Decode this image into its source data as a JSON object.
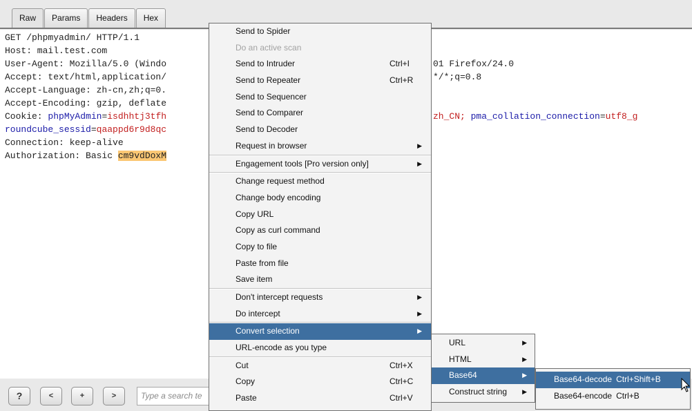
{
  "tabs": [
    "Raw",
    "Params",
    "Headers",
    "Hex"
  ],
  "request": {
    "line1": "GET /phpmyadmin/ HTTP/1.1",
    "line2": "Host: mail.test.com",
    "line3a": "User-Agent: Mozilla/5.0 (Windo",
    "line3b": "01 Firefox/24.0",
    "line4a": "Accept: text/html,application/",
    "line4b": "*/*;q=0.8",
    "line5": "Accept-Language: zh-cn,zh;q=0.",
    "line6": "Accept-Encoding: gzip, deflate",
    "cookie_prefix": "Cookie: ",
    "cookie_key1": "phpMyAdmin",
    "cookie_eq": "=",
    "cookie_val1": "isdhhtj3tfh",
    "cookie_tail_val": "zh_CN; ",
    "cookie_key2": "pma_collation_connection",
    "cookie_eq2": "=",
    "cookie_val2": "utf8_g",
    "rc_key": "roundcube_sessid",
    "rc_eq": "=",
    "rc_val": "qaappd6r9d8qc",
    "connection": "Connection: keep-alive",
    "auth_prefix": "Authorization: Basic ",
    "auth_value": "cm9vdDoxM"
  },
  "bottom": {
    "help": "?",
    "prev": "<",
    "plus": "+",
    "next": ">",
    "search_placeholder": "Type a search te"
  },
  "context_menu": {
    "send_to_spider": "Send to Spider",
    "active_scan": "Do an active scan",
    "send_to_intruder": "Send to Intruder",
    "send_to_intruder_sc": "Ctrl+I",
    "send_to_repeater": "Send to Repeater",
    "send_to_repeater_sc": "Ctrl+R",
    "send_to_sequencer": "Send to Sequencer",
    "send_to_comparer": "Send to Comparer",
    "send_to_decoder": "Send to Decoder",
    "request_in_browser": "Request in browser",
    "engagement_tools": "Engagement tools [Pro version only]",
    "change_method": "Change request method",
    "change_encoding": "Change body encoding",
    "copy_url": "Copy URL",
    "copy_curl": "Copy as curl command",
    "copy_to_file": "Copy to file",
    "paste_from_file": "Paste from file",
    "save_item": "Save item",
    "dont_intercept": "Don't intercept requests",
    "do_intercept": "Do intercept",
    "convert_selection": "Convert selection",
    "url_encode_typing": "URL-encode as you type",
    "cut": "Cut",
    "cut_sc": "Ctrl+X",
    "copy": "Copy",
    "copy_sc": "Ctrl+C",
    "paste": "Paste",
    "paste_sc": "Ctrl+V",
    "arrow": "▶"
  },
  "convert_submenu": {
    "url": "URL",
    "html": "HTML",
    "base64": "Base64",
    "construct_string": "Construct string"
  },
  "base64_submenu": {
    "decode": "Base64-decode",
    "decode_sc": "Ctrl+Shift+B",
    "encode": "Base64-encode",
    "encode_sc": "Ctrl+B"
  },
  "colors": {
    "menu_selection": "#3e6fa0",
    "highlight": "#fbc773",
    "param_name": "#1b1ba8",
    "param_value": "#c21f1f"
  }
}
